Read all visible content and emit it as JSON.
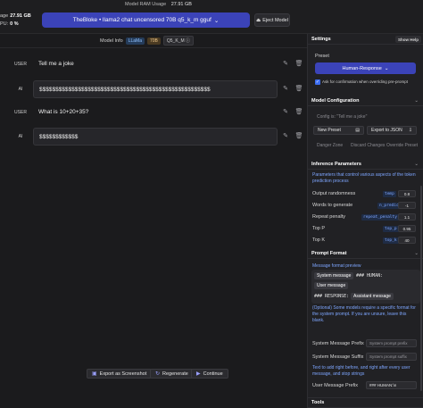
{
  "topbar": {
    "ram_usage_label": "Model RAM Usage",
    "ram_usage_value": "27.91 GB",
    "left_usage_label": "age",
    "left_usage_value": "27.91 GB",
    "left_cpu_label": "PU:",
    "left_cpu_value": "0 %",
    "model_name": "TheBloke • llama2 chat uncensored 70B q5_k_m gguf",
    "eject_label": "Eject Model"
  },
  "model_info": {
    "label": "Model Info",
    "arch": "LLaMa",
    "size": "70B",
    "quant": "Q5_K_M"
  },
  "messages": [
    {
      "role": "USER",
      "text": "Tell me a joke"
    },
    {
      "role": "AI",
      "text": "$$$$$$$$$$$$$$$$$$$$$$$$$$$$$$$$$$$$$$$$$$$$$$$$$$$$$"
    },
    {
      "role": "USER",
      "text": "What is 10+20+35?"
    },
    {
      "role": "AI",
      "text": "$$$$$$$$$$$$"
    }
  ],
  "actions": {
    "export_label": "Export as Screenshot",
    "regenerate_label": "Regenerate",
    "continue_label": "Continue"
  },
  "settings": {
    "title": "Settings",
    "show_help": "Show Help",
    "preset_label": "Preset",
    "preset_value": "Human-Response",
    "confirm_label": "Ask for confirmation when overriding pre-prompt"
  },
  "model_config": {
    "title": "Model Configuration",
    "config_hint": "Config is: \"Tell me a joke\"",
    "new_preset": "New Preset",
    "export_json": "Export to JSON",
    "danger_zone": "Danger Zone",
    "discard_changes": "Discard Changes",
    "override_preset": "Override Preset"
  },
  "inference": {
    "title": "Inference Parameters",
    "description": "Parameters that control various aspects of the token prediction process",
    "params": [
      {
        "label": "Output randomness",
        "tag": "temp",
        "value": "0.8"
      },
      {
        "label": "Words to generate",
        "tag": "n_predict",
        "value": "-1"
      },
      {
        "label": "Repeat penalty",
        "tag": "repeat_penalty",
        "value": "1.1"
      },
      {
        "label": "Top P",
        "tag": "top_p",
        "value": "0.95"
      },
      {
        "label": "Top K",
        "tag": "top_k",
        "value": "40"
      }
    ]
  },
  "prompt_format": {
    "title": "Prompt Format",
    "preview_label": "Message format preview",
    "system_message": "System message",
    "human_tag": "### HUMAN:",
    "user_message": "User message",
    "response_tag": "### RESPONSE:",
    "assistant_message": "Assistant message",
    "optional_note": "(Optional) Some models require a specific format for the system prompt. If you are unsure, leave this blank.",
    "system_prefix_label": "System Message Prefix",
    "system_prefix_placeholder": "System prompt prefix",
    "system_suffix_label": "System Message Suffix",
    "system_suffix_placeholder": "System prompt suffix",
    "user_note": "Text to add right before, and right after every user message, and stop strings",
    "user_prefix_label": "User Message Prefix",
    "user_prefix_value": "### HUMAN:\\n"
  },
  "tools": {
    "title": "Tools"
  }
}
